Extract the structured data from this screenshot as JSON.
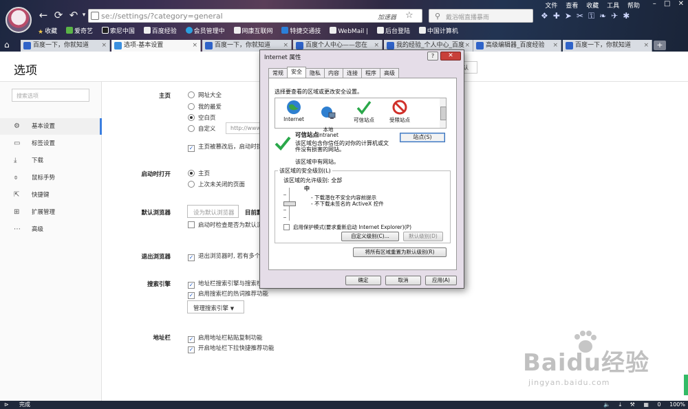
{
  "browser": {
    "menu": [
      "文件",
      "查看",
      "收藏",
      "工具",
      "帮助"
    ],
    "address": "se://settings/?category=general",
    "accelerator": "加速器",
    "search_placeholder": "戴浴帽直播暴雨",
    "bookmarks": [
      "收藏",
      "爱奇艺",
      "索尼中国",
      "百度经验",
      "会员管理中",
      "网康互联网",
      "特捷交通技",
      "WebMail |",
      "后台登陆",
      "中国计算机"
    ],
    "tabs": [
      {
        "title": "百度一下，你就知道"
      },
      {
        "title": "选项-基本设置"
      },
      {
        "title": "百度一下，你就知道"
      },
      {
        "title": "百度个人中心——您在"
      },
      {
        "title": "我的经验_个人中心_百度"
      },
      {
        "title": "高级编辑器_百度经验"
      },
      {
        "title": "百度一下，你就知道"
      }
    ]
  },
  "settings": {
    "page_title": "选项",
    "search_placeholder": "搜索选项",
    "nav": [
      {
        "label": "基本设置"
      },
      {
        "label": "标签设置"
      },
      {
        "label": "下载"
      },
      {
        "label": "鼠标手势"
      },
      {
        "label": "快捷键"
      },
      {
        "label": "扩展管理"
      },
      {
        "label": "高级"
      }
    ],
    "homepage": {
      "label": "主页",
      "options": [
        "网址大全",
        "我的最爱",
        "空白页",
        "自定义"
      ],
      "custom_url": "http://www",
      "protect_text": "主页被篡改后，启动时提"
    },
    "startup": {
      "label": "启动时打开",
      "options": [
        "主页",
        "上次未关闭的页面"
      ]
    },
    "default_browser": {
      "label": "默认浏览器",
      "button": "设为默认浏览器",
      "current": "目前默",
      "check_text": "启动时检查是否为默认浏"
    },
    "exit": {
      "label": "退出浏览器",
      "check_text": "退出浏览器时, 若有多个"
    },
    "search_engine": {
      "label": "搜索引擎",
      "check1": "地址栏搜索引擎与搜索栏",
      "check2": "启用搜索栏的热词推荐功能",
      "manage_button": "管理搜索引擎"
    },
    "address_bar": {
      "label": "地址栏",
      "check1": "启用地址栏粘贴复制功能",
      "check2": "开启地址栏下拉快捷推荐功能"
    },
    "partial_right_text": "认"
  },
  "dialog": {
    "title": "Internet 属性",
    "help": "?",
    "close": "✕",
    "tabs": [
      "常规",
      "安全",
      "隐私",
      "内容",
      "连接",
      "程序",
      "高级"
    ],
    "zone_prompt": "选择要查看的区域或更改安全设置。",
    "zones": [
      {
        "name": "Internet"
      },
      {
        "name": "本地\nIntranet"
      },
      {
        "name": "可信站点"
      },
      {
        "name": "受限站点"
      }
    ],
    "zone_name": "可信站点",
    "zone_desc": "该区域包含你信任的对你的计算机或文件没有损害的网站。",
    "zone_count": "该区域中有网站。",
    "sites_button": "站点(S)",
    "level_title": "该区域的安全级别(L)",
    "level_allowed": "该区域的允许级别: 全部",
    "level_name": "中",
    "level_line1": "- 下载潜在不安全内容前提示",
    "level_line2": "- 不下载未签名的 ActiveX 控件",
    "protect_mode": "启用保护模式(要求重新启动 Internet Explorer)(P)",
    "custom_level": "自定义级别(C)...",
    "default_level": "默认级别(D)",
    "reset_all": "将所有区域重置为默认级别(R)",
    "ok": "确定",
    "cancel": "取消",
    "apply": "应用(A)"
  },
  "status": {
    "text": "完成",
    "right": [
      "0",
      "100%"
    ]
  },
  "watermark": {
    "brand": "Baidu经验",
    "url": "jingyan.baidu.com"
  }
}
